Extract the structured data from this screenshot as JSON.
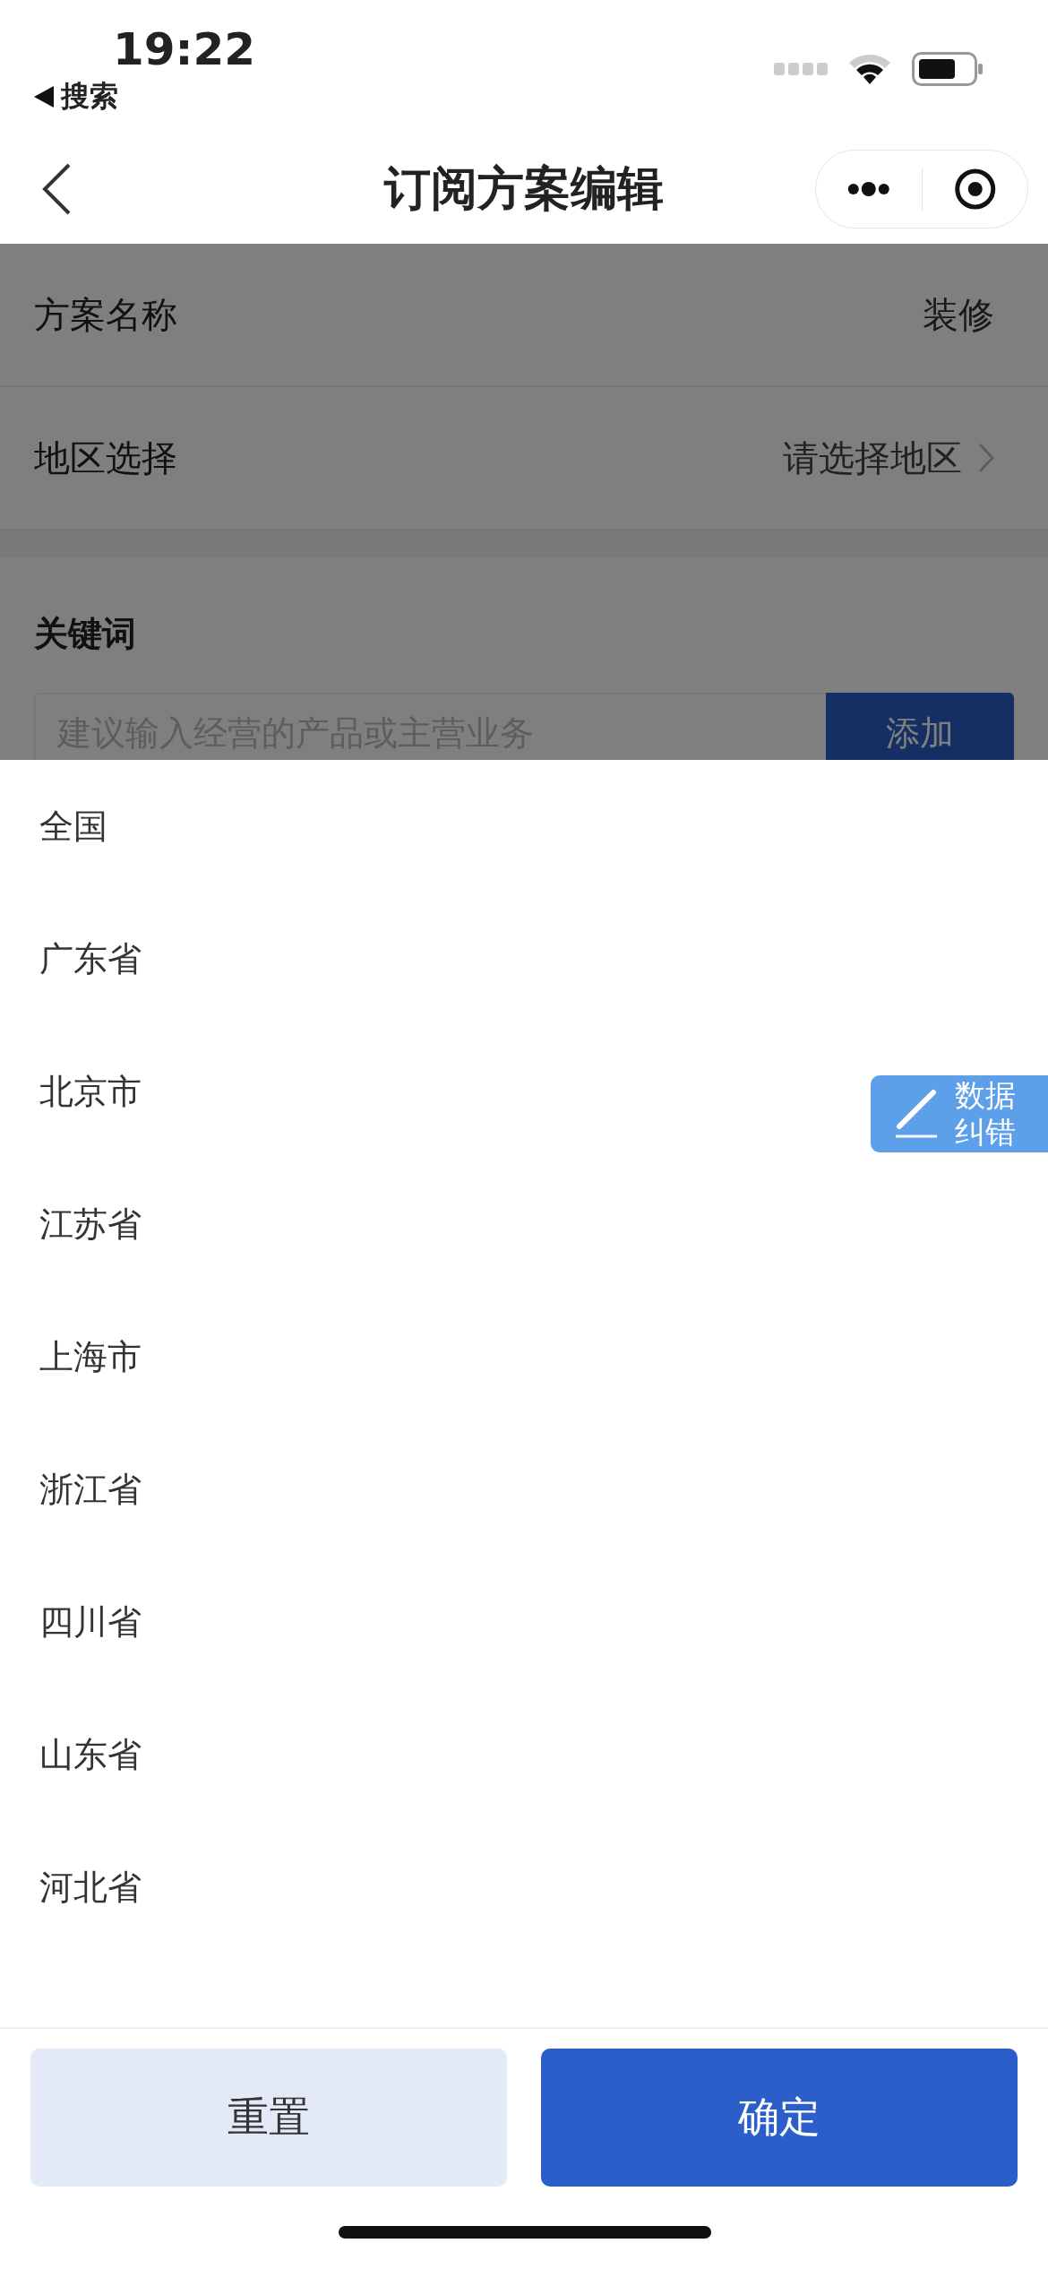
{
  "status_bar": {
    "time": "19:22",
    "back_app": "搜索"
  },
  "nav_bar": {
    "title": "订阅方案编辑"
  },
  "form": {
    "rows": [
      {
        "label": "方案名称",
        "value": "装修",
        "kind": "text"
      },
      {
        "label": "地区选择",
        "value": "请选择地区",
        "kind": "picker"
      }
    ],
    "keywords": {
      "label": "关键词",
      "placeholder": "建议输入经营的产品或主营业务",
      "add_button": "添加"
    }
  },
  "region_sheet": {
    "items": [
      "全国",
      "广东省",
      "北京市",
      "江苏省",
      "上海市",
      "浙江省",
      "四川省",
      "山东省",
      "河北省"
    ],
    "reset_button": "重置",
    "confirm_button": "确定"
  },
  "feedback_button": {
    "label": "数据纠错"
  }
}
